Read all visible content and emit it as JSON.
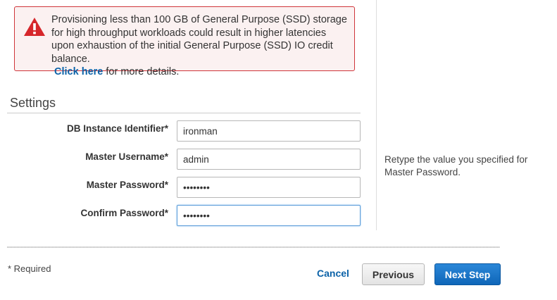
{
  "warning": {
    "text": "Provisioning less than 100 GB of General Purpose (SSD) storage for high throughput workloads could result in higher latencies upon exhaustion of the initial General Purpose (SSD) IO credit balance.",
    "link_label": "Click here",
    "link_suffix": " for more details."
  },
  "settings": {
    "title": "Settings",
    "fields": {
      "db_instance_identifier": {
        "label": "DB Instance Identifier*",
        "value": "ironman"
      },
      "master_username": {
        "label": "Master Username*",
        "value": "admin"
      },
      "master_password": {
        "label": "Master Password*",
        "value": "••••••••"
      },
      "confirm_password": {
        "label": "Confirm Password*",
        "value": "••••••••"
      }
    },
    "help_text": "Retype the value you specified for Master Password."
  },
  "footer": {
    "required_note": "* Required",
    "cancel_label": "Cancel",
    "previous_label": "Previous",
    "next_label": "Next Step"
  },
  "colors": {
    "warning_border": "#d0353a",
    "warning_icon": "#d6262b",
    "link": "#0b62a8",
    "primary_button": "#1a73c9"
  },
  "icons": {
    "warning": "warning-triangle-icon"
  }
}
